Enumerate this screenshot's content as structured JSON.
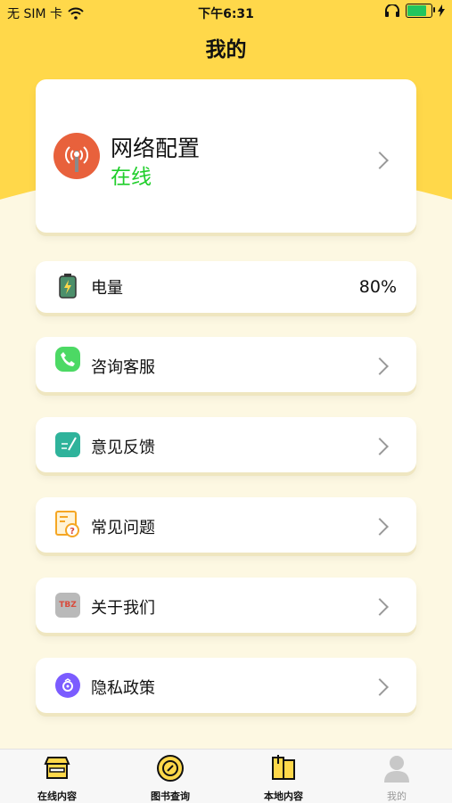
{
  "status_bar": {
    "carrier": "无 SIM 卡",
    "time": "下午6:31",
    "wifi_icon": "wifi-icon",
    "headphones_icon": "headphones-icon",
    "battery_icon": "battery-icon",
    "charging_icon": "charging-icon"
  },
  "header": {
    "title": "我的"
  },
  "network": {
    "title": "网络配置",
    "status": "在线",
    "status_color": "#1fce2a",
    "icon": "antenna-icon"
  },
  "items": [
    {
      "label": "电量",
      "value": "80%",
      "icon": "battery-level-icon",
      "icon_color": "#4c8f6b"
    },
    {
      "label": "咨询客服",
      "icon": "phone-icon",
      "icon_color": "#4cd964"
    },
    {
      "label": "意见反馈",
      "icon": "feedback-icon",
      "icon_color": "#2fb39b"
    },
    {
      "label": "常见问题",
      "icon": "faq-icon",
      "icon_color": "#f5a623"
    },
    {
      "label": "关于我们",
      "icon": "tbz-logo-icon",
      "icon_color": "#d94a3b",
      "icon_text": "TBZ"
    },
    {
      "label": "隐私政策",
      "icon": "privacy-icon",
      "icon_color": "#7b5cff"
    }
  ],
  "tabbar": {
    "tabs": [
      {
        "label": "在线内容",
        "icon": "store-icon",
        "active": true
      },
      {
        "label": "图书查询",
        "icon": "compass-icon",
        "active": true
      },
      {
        "label": "本地内容",
        "icon": "book-icon",
        "active": true
      },
      {
        "label": "我的",
        "icon": "profile-icon",
        "active": false
      }
    ]
  },
  "colors": {
    "accent": "#ffd84a",
    "background": "#fdf8e2"
  }
}
